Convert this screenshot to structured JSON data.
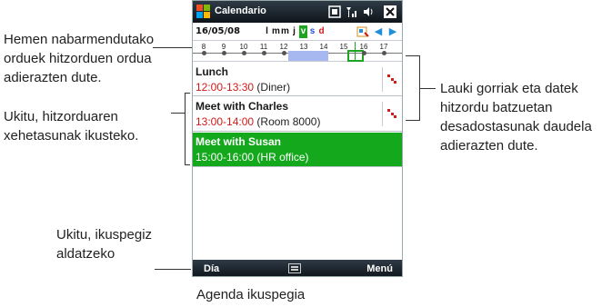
{
  "callouts": {
    "highlighted_hours": "Hemen nabarmendutako\norduek hitzorduen ordua\nadierazten dute.",
    "tap_details": "Ukitu, hitzorduaren\nxehetasunak ikusteko.",
    "switch_view": "Ukitu, ikuspegiz\naldatzeko",
    "red_boxes": "Lauki gorriak eta datek\nhitzordu batzuetan\ndesadostasunak daudela\nadierazten dute."
  },
  "caption": "Agenda ikuspegia",
  "device": {
    "app_title": "Calendario",
    "date": "16/05/08",
    "weekdays": [
      "l",
      "m",
      "m",
      "j",
      "v",
      "s",
      "d"
    ],
    "selected_weekday_index": 4,
    "timeline_hours": [
      "8",
      "9",
      "10",
      "11",
      "12",
      "13",
      "14",
      "15",
      "16",
      "17"
    ],
    "appointments": [
      {
        "title": "Lunch",
        "time": "12:00-13:30",
        "location": "(Diner)",
        "conflict": true,
        "highlighted": false
      },
      {
        "title": "Meet with Charles",
        "time": "13:00-14:00",
        "location": "(Room 8000)",
        "conflict": true,
        "highlighted": false
      },
      {
        "title": "Meet with Susan",
        "time": "15:00-16:00",
        "location": "(HR office)",
        "conflict": false,
        "highlighted": true
      }
    ],
    "softkeys": {
      "left": "Día",
      "right": "Menú"
    }
  },
  "colors": {
    "highlight_green": "#14a81c",
    "time_red": "#d11a1a",
    "timeline_band": "#a6b8ef",
    "titlebar_dark": "#0e141a"
  },
  "icons": [
    "windows-logo-icon",
    "connectivity-icon",
    "signal-icon",
    "volume-icon",
    "close-icon",
    "week-view-icon",
    "arrow-left-icon",
    "arrow-right-icon",
    "conflict-icon",
    "keyboard-icon"
  ]
}
